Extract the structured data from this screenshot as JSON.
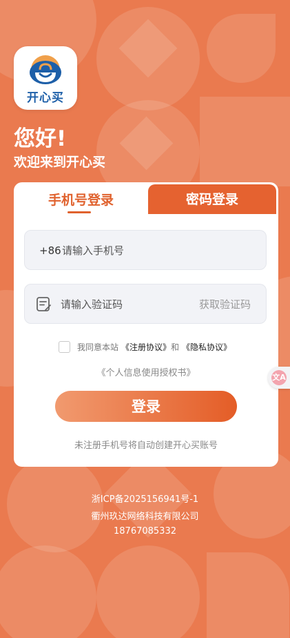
{
  "app": {
    "logo_text": "开心买",
    "greeting": "您好!",
    "welcome": "欢迎来到开心买"
  },
  "tabs": {
    "sms_login": "手机号登录",
    "password_login": "密码登录"
  },
  "phone": {
    "prefix": "+86",
    "placeholder": "请输入手机号",
    "value": ""
  },
  "code": {
    "placeholder": "请输入验证码",
    "value": "",
    "get_code": "获取验证码"
  },
  "agreement": {
    "prefix": "我同意本站",
    "user_agreement": "《注册协议》",
    "and": "和",
    "privacy": "《隐私协议》",
    "personal_info": "《个人信息使用授权书》"
  },
  "login_button": "登录",
  "hint": "未注册手机号将自动创建开心买账号",
  "footer": {
    "icp": "浙ICP备2025156941号-1",
    "company": "衢州玖达网络科技有限公司",
    "phone": "18767085332"
  },
  "colors": {
    "background": "#ea7a4f",
    "accent": "#e56230",
    "logo_blue": "#1d5fa8"
  },
  "icons": {
    "code": "document-edit-icon",
    "translate": "translate-icon"
  }
}
